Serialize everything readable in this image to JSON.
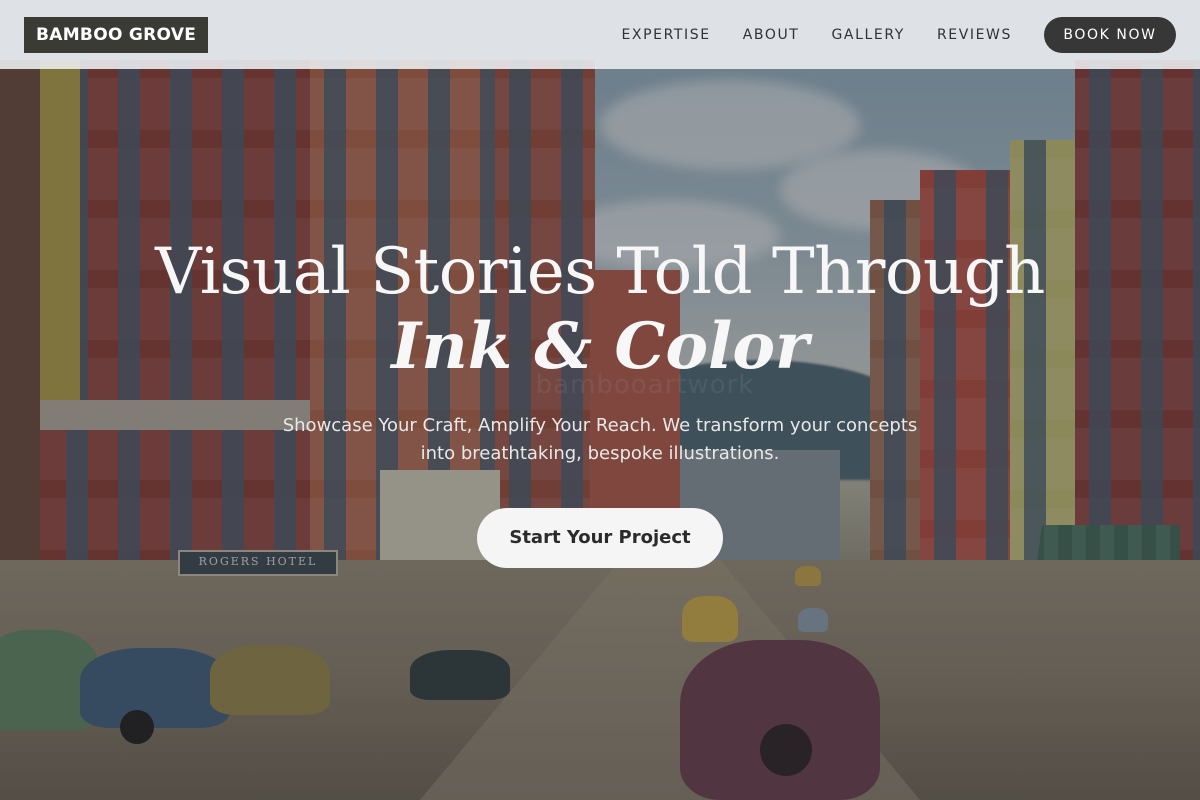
{
  "navbar": {
    "brand": "BAMBOO GROVE",
    "links": [
      "EXPERTISE",
      "ABOUT",
      "GALLERY",
      "REVIEWS"
    ],
    "cta": "BOOK NOW"
  },
  "hero": {
    "headline_line1": "Visual Stories Told Through",
    "headline_line2": "Ink & Color",
    "subtitle": "Showcase Your Craft, Amplify Your Reach. We transform your concepts into breathtaking, bespoke illustrations.",
    "cta": "Start Your Project",
    "background_sign": "ROGERS HOTEL"
  },
  "colors": {
    "nav_bg": "#eef0f3",
    "brand_bg": "#3b3b36",
    "button_dark": "#373737",
    "cta_bg": "#f5f5f5"
  }
}
